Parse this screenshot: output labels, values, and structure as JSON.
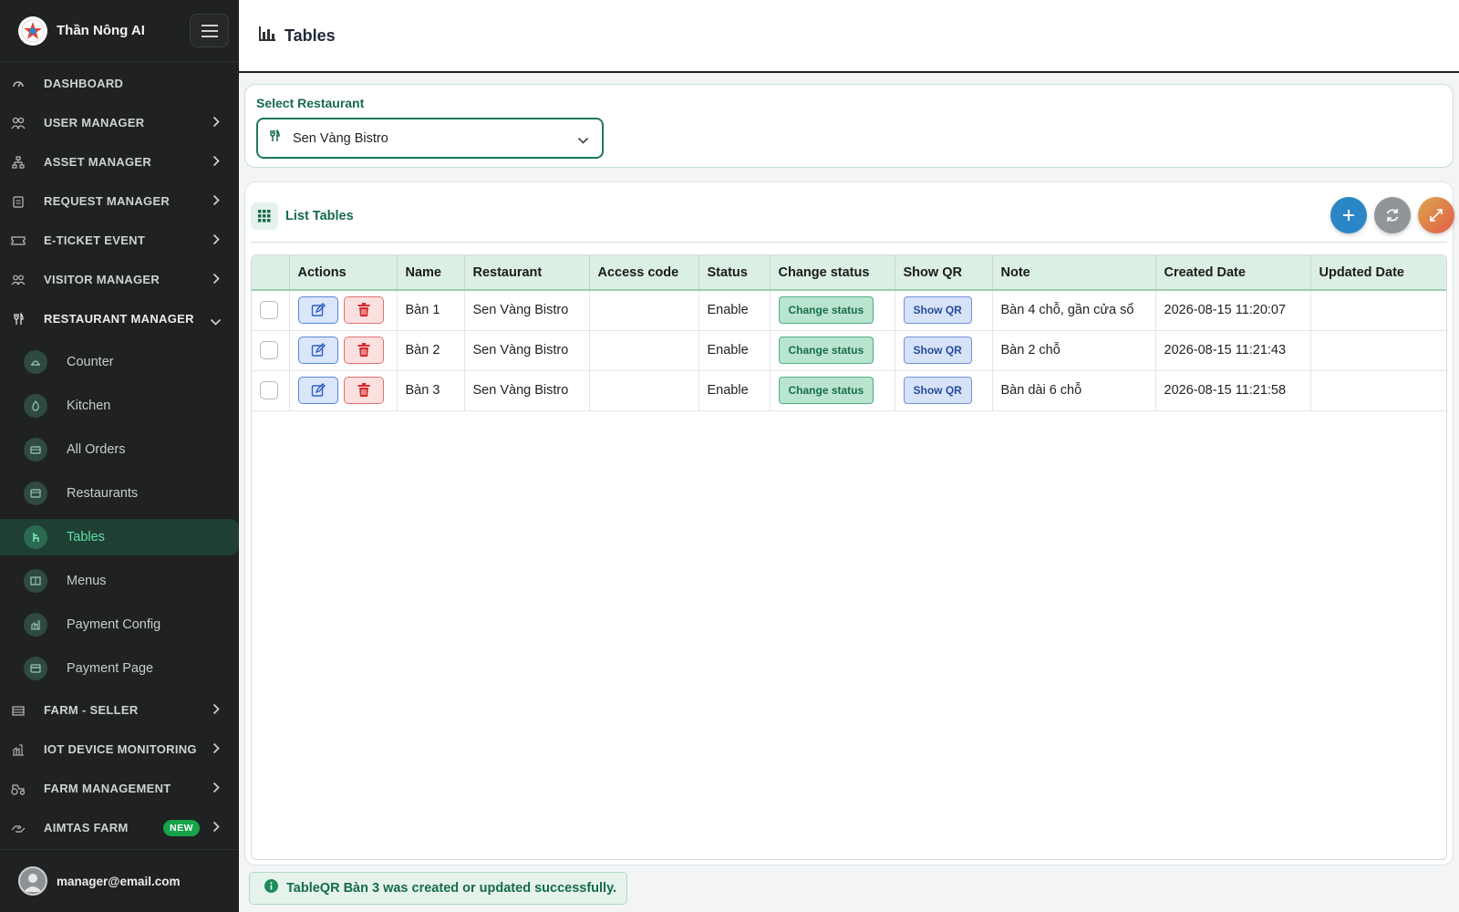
{
  "app": {
    "title": "Thần Nông AI"
  },
  "sidebar": {
    "items": [
      {
        "label": "DASHBOARD",
        "icon": "gauge-icon",
        "chevron": false
      },
      {
        "label": "USER MANAGER",
        "icon": "users-cog-icon",
        "chevron": true
      },
      {
        "label": "ASSET MANAGER",
        "icon": "sitemap-icon",
        "chevron": true
      },
      {
        "label": "REQUEST MANAGER",
        "icon": "clipboard-icon",
        "chevron": true
      },
      {
        "label": "E-TICKET EVENT",
        "icon": "ticket-icon",
        "chevron": true
      },
      {
        "label": "VISITOR MANAGER",
        "icon": "visitors-icon",
        "chevron": true
      },
      {
        "label": "RESTAURANT MANAGER",
        "icon": "utensils-icon",
        "chevron": "down"
      }
    ],
    "sub_items": [
      {
        "label": "Counter",
        "icon": "counter-icon"
      },
      {
        "label": "Kitchen",
        "icon": "fire-icon"
      },
      {
        "label": "All Orders",
        "icon": "orders-icon"
      },
      {
        "label": "Restaurants",
        "icon": "store-icon"
      },
      {
        "label": "Tables",
        "icon": "chair-icon",
        "active": true
      },
      {
        "label": "Menus",
        "icon": "book-icon"
      },
      {
        "label": "Payment Config",
        "icon": "config-icon"
      },
      {
        "label": "Payment Page",
        "icon": "card-icon"
      }
    ],
    "bottom_items": [
      {
        "label": "FARM - SELLER",
        "icon": "seller-icon"
      },
      {
        "label": "IOT DEVICE MONITORING",
        "icon": "iot-icon"
      },
      {
        "label": "FARM MANAGEMENT",
        "icon": "tractor-icon"
      },
      {
        "label": "AIMTAS FARM",
        "icon": "hand-icon",
        "badge": "NEW"
      }
    ],
    "user": {
      "email": "manager@email.com"
    }
  },
  "header": {
    "title": "Tables"
  },
  "select_restaurant": {
    "label": "Select Restaurant",
    "value": "Sen Vàng Bistro"
  },
  "list": {
    "title": "List Tables",
    "columns": [
      "",
      "Actions",
      "Name",
      "Restaurant",
      "Access code",
      "Status",
      "Change status",
      "Show QR",
      "Note",
      "Created Date",
      "Updated Date"
    ],
    "rows": [
      {
        "name": "Bàn 1",
        "restaurant": "Sen Vàng Bistro",
        "access_code": "",
        "status": "Enable",
        "change_status": "Change status",
        "show_qr": "Show QR",
        "note": "Bàn 4 chỗ, gần cửa sổ",
        "created": "2026-08-15 11:20:07",
        "updated": ""
      },
      {
        "name": "Bàn 2",
        "restaurant": "Sen Vàng Bistro",
        "access_code": "",
        "status": "Enable",
        "change_status": "Change status",
        "show_qr": "Show QR",
        "note": "Bàn 2 chỗ",
        "created": "2026-08-15 11:21:43",
        "updated": ""
      },
      {
        "name": "Bàn 3",
        "restaurant": "Sen Vàng Bistro",
        "access_code": "",
        "status": "Enable",
        "change_status": "Change status",
        "show_qr": "Show QR",
        "note": "Bàn dài 6 chỗ",
        "created": "2026-08-15 11:21:58",
        "updated": ""
      }
    ]
  },
  "toast": {
    "message": "TableQR Bàn 3 was created or updated successfully."
  },
  "colors": {
    "accent": "#166b4a",
    "sidebar_bg": "#1f2122",
    "active_text": "#5fe0a6",
    "add_button": "#2a86c7"
  }
}
